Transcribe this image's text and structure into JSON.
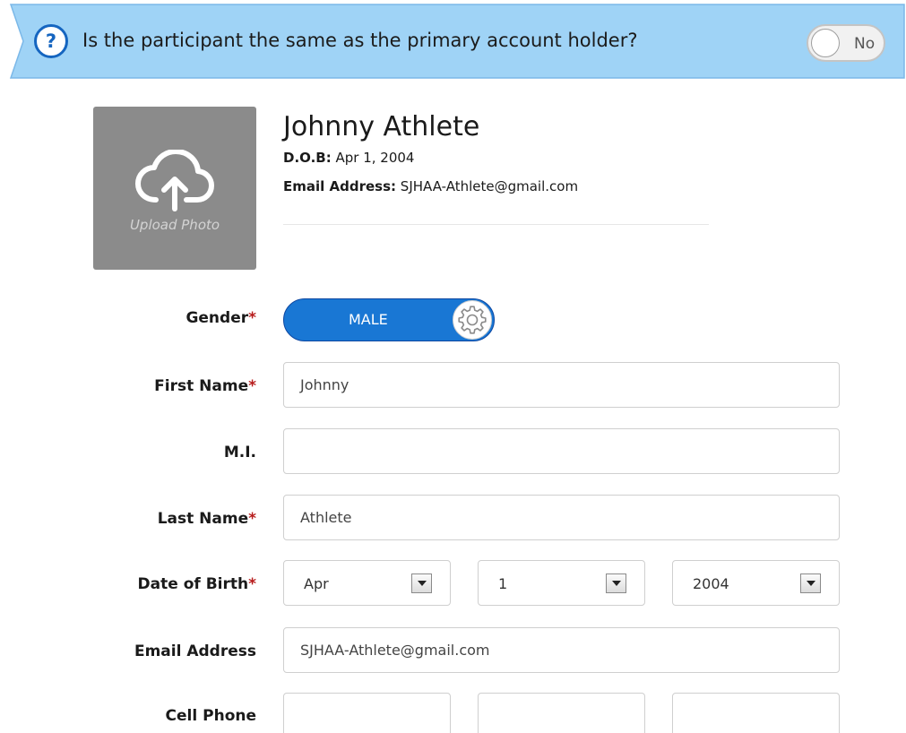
{
  "banner": {
    "question": "Is the participant the same as the primary account holder?",
    "toggle_label": "No",
    "bg_color": "#9fd3f6",
    "border_color": "#7bb8e8"
  },
  "profile": {
    "upload_label": "Upload Photo",
    "name": "Johnny Athlete",
    "dob_label": "D.O.B:",
    "dob_value": "Apr 1, 2004",
    "email_label": "Email Address:",
    "email_value": "SJHAA-Athlete@gmail.com"
  },
  "form": {
    "required_mark": "*",
    "gender": {
      "label": "Gender",
      "value": "MALE"
    },
    "first_name": {
      "label": "First Name",
      "value": "Johnny"
    },
    "mi": {
      "label": "M.I.",
      "value": ""
    },
    "last_name": {
      "label": "Last Name",
      "value": "Athlete"
    },
    "dob": {
      "label": "Date of Birth",
      "month": "Apr",
      "day": "1",
      "year": "2004"
    },
    "email": {
      "label": "Email Address",
      "value": "SJHAA-Athlete@gmail.com"
    },
    "cell_phone": {
      "label": "Cell Phone"
    }
  },
  "colors": {
    "accent": "#1977d4",
    "required": "#b71c1c"
  }
}
